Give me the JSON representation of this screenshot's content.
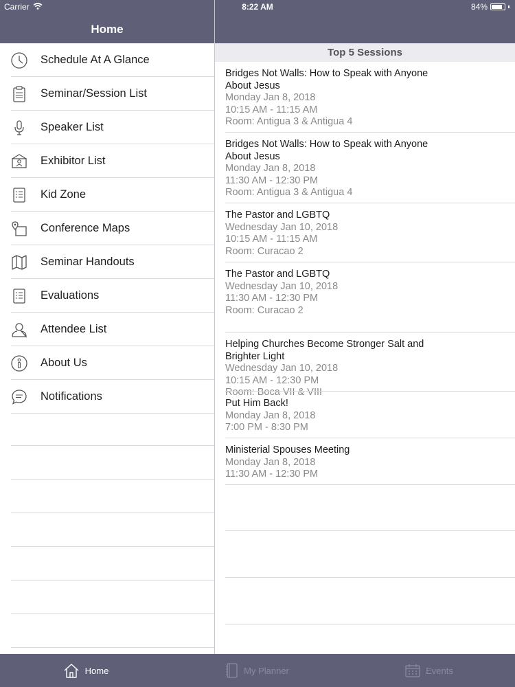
{
  "status_bar": {
    "carrier": "Carrier",
    "time": "8:22 AM",
    "battery": "84%",
    "battery_level": 0.84
  },
  "sidebar": {
    "title": "Home",
    "items": [
      {
        "label": "Schedule At A Glance",
        "icon": "clock-icon"
      },
      {
        "label": "Seminar/Session List",
        "icon": "clipboard-icon"
      },
      {
        "label": "Speaker List",
        "icon": "microphone-icon"
      },
      {
        "label": "Exhibitor List",
        "icon": "exhibitor-booth-icon"
      },
      {
        "label": "Kid Zone",
        "icon": "list-icon"
      },
      {
        "label": "Conference Maps",
        "icon": "map-pin-icon"
      },
      {
        "label": "Seminar Handouts",
        "icon": "folded-map-icon"
      },
      {
        "label": "Evaluations",
        "icon": "list-icon"
      },
      {
        "label": "Attendee List",
        "icon": "person-icon"
      },
      {
        "label": "About Us",
        "icon": "info-icon"
      },
      {
        "label": "Notifications",
        "icon": "chat-bubble-icon"
      }
    ]
  },
  "main": {
    "section_title": "Top 5 Sessions",
    "sessions": [
      {
        "title": "Bridges Not Walls: How to Speak with Anyone About Jesus",
        "date": "Monday Jan 8, 2018",
        "time": "10:15 AM - 11:15 AM",
        "room": "Room: Antigua 3 & Antigua 4"
      },
      {
        "title": "Bridges Not Walls: How to Speak with Anyone About Jesus",
        "date": "Monday Jan 8, 2018",
        "time": "11:30 AM - 12:30 PM",
        "room": "Room: Antigua 3 & Antigua 4"
      },
      {
        "title": "The Pastor and LGBTQ",
        "date": "Wednesday Jan 10, 2018",
        "time": "10:15 AM - 11:15 AM",
        "room": "Room: Curacao 2"
      },
      {
        "title": "The Pastor and LGBTQ",
        "date": "Wednesday Jan 10, 2018",
        "time": "11:30 AM - 12:30 PM",
        "room": "Room: Curacao 2"
      },
      {
        "title": "Helping Churches Become Stronger Salt and Brighter Light",
        "date": "Wednesday Jan 10, 2018",
        "time": "10:15 AM - 12:30 PM",
        "room": "Room: Boca VII & VIII"
      },
      {
        "title": "Put Him Back!",
        "date": "Monday Jan 8, 2018",
        "time": "7:00 PM - 8:30 PM",
        "room": ""
      },
      {
        "title": "Ministerial Spouses Meeting",
        "date": "Monday Jan 8, 2018",
        "time": "11:30 AM - 12:30 PM",
        "room": ""
      }
    ]
  },
  "tabbar": {
    "tabs": [
      {
        "label": "Home",
        "icon": "house-icon",
        "active": true
      },
      {
        "label": "My Planner",
        "icon": "planner-icon",
        "active": false
      },
      {
        "label": "Events",
        "icon": "calendar-icon",
        "active": false
      }
    ]
  },
  "colors": {
    "header": "#5f6077",
    "section_header": "#ececf0",
    "meta_text": "#8a8a8a"
  }
}
